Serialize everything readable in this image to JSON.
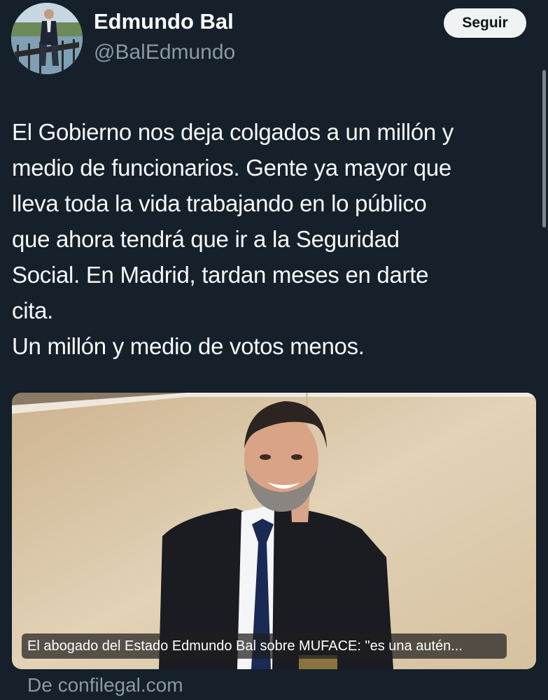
{
  "author": {
    "display_name": "Edmundo Bal",
    "handle": "@BalEdmundo",
    "avatar_icon": "profile-photo"
  },
  "follow_button": {
    "label": "Seguir"
  },
  "tweet": {
    "lines": [
      "El Gobierno nos deja colgados a un millón y",
      "medio de funcionarios. Gente ya mayor que",
      "lleva toda la vida trabajando en lo público",
      "que ahora tendrá que ir a la Seguridad",
      "Social. En Madrid, tardan meses en darte",
      "cita.",
      "Un millón y medio de votos menos."
    ]
  },
  "link_card": {
    "caption": "El abogado del Estado Edmundo Bal sobre MUFACE: \"es una autén...",
    "source": "De confilegal.com"
  },
  "colors": {
    "background": "#15202b",
    "text": "#f7f9f9",
    "secondary_text": "#8b98a5",
    "follow_button_bg": "#eff3f4"
  }
}
